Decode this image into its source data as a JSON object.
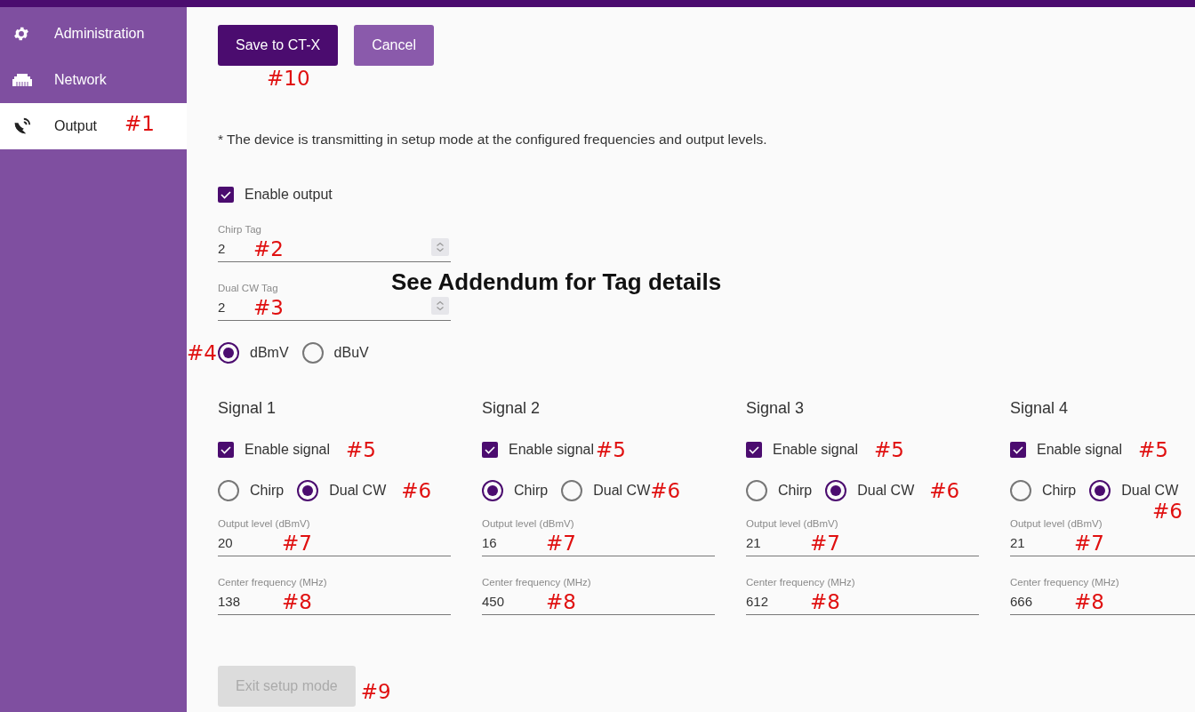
{
  "sidebar": {
    "items": [
      {
        "label": "Administration",
        "selected": false
      },
      {
        "label": "Network",
        "selected": false
      },
      {
        "label": "Output",
        "selected": true,
        "annotation": "#1"
      }
    ]
  },
  "toolbar": {
    "buttons": [
      {
        "label": "Save to CT-X",
        "kind": "primary",
        "annotation": "#10"
      },
      {
        "label": "Cancel",
        "kind": "secondary"
      }
    ]
  },
  "note": "* The device is transmitting in setup mode at the configured frequencies and output levels.",
  "enable_output": {
    "label": "Enable output",
    "checked": true
  },
  "tag_fields": [
    {
      "label": "Chirp Tag",
      "value": "2",
      "annotation": "#2"
    },
    {
      "label": "Dual CW Tag",
      "value": "2",
      "annotation": "#3"
    }
  ],
  "callout": "See Addendum for Tag details",
  "unit_options": {
    "annotation": "#4",
    "options": [
      {
        "label": "dBmV",
        "selected": true
      },
      {
        "label": "dBuV",
        "selected": false
      }
    ]
  },
  "signals": [
    {
      "title": "Signal 1",
      "enable": {
        "label": "Enable signal",
        "checked": true,
        "annotation": "#5"
      },
      "modes": [
        {
          "label": "Chirp",
          "selected": false
        },
        {
          "label": "Dual CW",
          "selected": true
        }
      ],
      "modes_annotation": "#6",
      "fields": [
        {
          "label": "Output level (dBmV)",
          "value": "20",
          "annotation": "#7"
        },
        {
          "label": "Center frequency (MHz)",
          "value": "138",
          "annotation": "#8"
        }
      ]
    },
    {
      "title": "Signal 2",
      "enable": {
        "label": "Enable signal",
        "checked": true,
        "annotation": "#5"
      },
      "modes": [
        {
          "label": "Chirp",
          "selected": true
        },
        {
          "label": "Dual CW",
          "selected": false
        }
      ],
      "modes_annotation": "#6",
      "fields": [
        {
          "label": "Output level (dBmV)",
          "value": "16",
          "annotation": "#7"
        },
        {
          "label": "Center frequency (MHz)",
          "value": "450",
          "annotation": "#8"
        }
      ]
    },
    {
      "title": "Signal 3",
      "enable": {
        "label": "Enable signal",
        "checked": true,
        "annotation": "#5"
      },
      "modes": [
        {
          "label": "Chirp",
          "selected": false
        },
        {
          "label": "Dual CW",
          "selected": true
        }
      ],
      "modes_annotation": "#6",
      "fields": [
        {
          "label": "Output level (dBmV)",
          "value": "21",
          "annotation": "#7"
        },
        {
          "label": "Center frequency (MHz)",
          "value": "612",
          "annotation": "#8"
        }
      ]
    },
    {
      "title": "Signal 4",
      "enable": {
        "label": "Enable signal",
        "checked": true,
        "annotation": "#5"
      },
      "modes": [
        {
          "label": "Chirp",
          "selected": false
        },
        {
          "label": "Dual CW",
          "selected": true
        }
      ],
      "modes_annotation": "#6",
      "fields": [
        {
          "label": "Output level (dBmV)",
          "value": "21",
          "annotation": "#7"
        },
        {
          "label": "Center frequency (MHz)",
          "value": "666",
          "annotation": "#8"
        }
      ]
    }
  ],
  "exit_button": {
    "label": "Exit setup mode",
    "disabled": true,
    "annotation": "#9"
  }
}
